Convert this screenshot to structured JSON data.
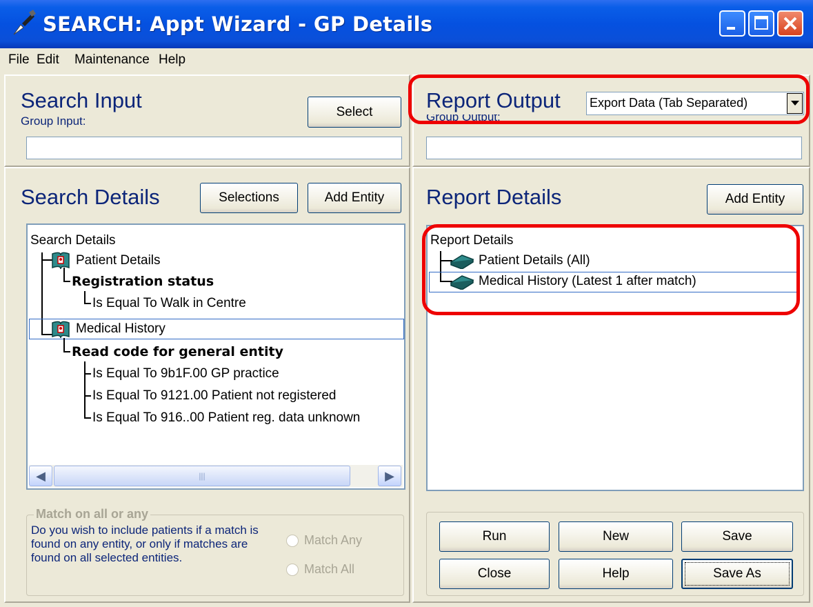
{
  "window": {
    "title": "SEARCH: Appt Wizard - GP Details"
  },
  "menu": [
    "File",
    "Edit",
    "Maintenance",
    "Help"
  ],
  "search_input": {
    "heading": "Search Input",
    "group_label": "Group Input:",
    "select_button": "Select",
    "value": ""
  },
  "report_output": {
    "heading": "Report Output",
    "group_label": "Group Output:",
    "format_selected": "Export Data (Tab Separated)",
    "value": ""
  },
  "search_details": {
    "heading": "Search Details",
    "selections_button": "Selections",
    "add_entity_button": "Add Entity",
    "tree_root": "Search Details",
    "tree": {
      "patient_details": "Patient Details",
      "registration_status": "Registration status",
      "reg_condition": "Is Equal To Walk in Centre",
      "medical_history": "Medical History",
      "read_code": "Read code for general entity",
      "condition_1": "Is Equal To 9b1F.00 GP practice",
      "condition_2": "Is Equal To 9121.00 Patient not registered",
      "condition_3": "Is Equal To 916..00 Patient reg. data unknown"
    }
  },
  "report_details": {
    "heading": "Report Details",
    "add_entity_button": "Add Entity",
    "tree_root": "Report Details",
    "items": [
      "Patient Details (All)",
      "Medical History (Latest 1 after match)"
    ]
  },
  "match": {
    "legend": "Match on all or any",
    "description": "Do you wish to include patients if a match is found on any entity, or only if matches are found on all selected entities.",
    "option_any": "Match Any",
    "option_all": "Match All"
  },
  "buttons": {
    "run": "Run",
    "new": "New",
    "save": "Save",
    "close": "Close",
    "help": "Help",
    "save_as": "Save As"
  },
  "colors": {
    "title_bar": "#0551e0",
    "heading_text": "#0c2579",
    "highlight": "#ee0000"
  }
}
